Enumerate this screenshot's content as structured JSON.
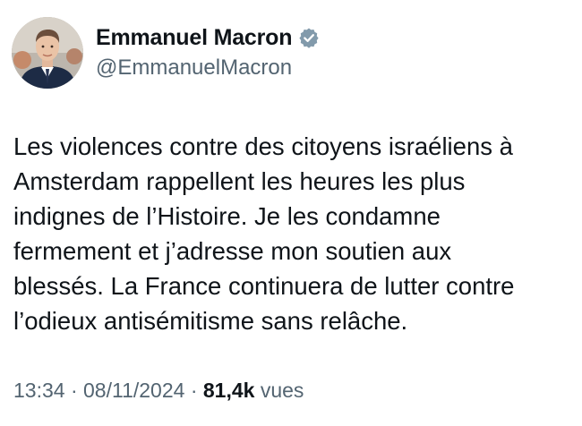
{
  "author": {
    "display_name": "Emmanuel Macron",
    "handle": "@EmmanuelMacron",
    "verified_color": "#829aab",
    "avatar_icon": "profile-photo"
  },
  "tweet": {
    "lines": [
      "Les violences contre des citoyens israéliens à",
      "Amsterdam rappellent les heures les plus",
      "indignes de l’Histoire. Je les condamne",
      "fermement et j’adresse mon soutien aux",
      "blessés. La France continuera de lutter contre",
      "l’odieux antisémitisme sans relâche."
    ]
  },
  "meta": {
    "time": "13:34",
    "separator": "·",
    "date": "08/11/2024",
    "views_count": "81,4k",
    "views_label": "vues"
  }
}
